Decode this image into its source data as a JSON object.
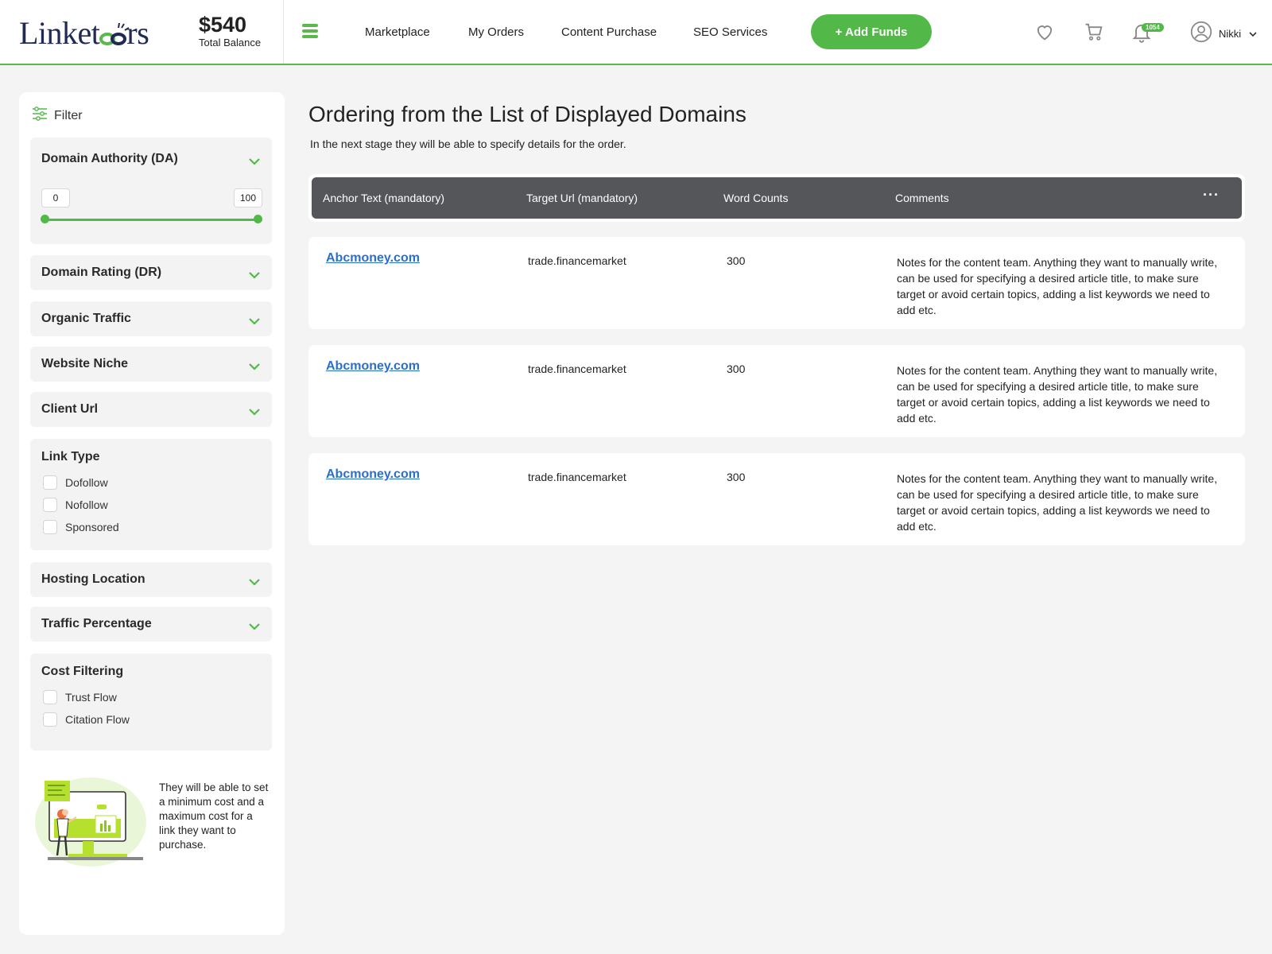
{
  "header": {
    "logo_text_a": "Linket",
    "logo_text_b": "rs",
    "balance_amount": "$540",
    "balance_label": "Total Balance",
    "nav": [
      "Marketplace",
      "My Orders",
      "Content Purchase",
      "SEO Services"
    ],
    "add_funds_label": "+ Add Funds",
    "notification_count": "1054",
    "user_name": "Nikki",
    "icons": [
      "heart-icon",
      "cart-icon",
      "bell-icon",
      "user-avatar-icon"
    ],
    "accent_color": "#52b848"
  },
  "sidebar": {
    "filter_label": "Filter",
    "domain_authority": {
      "title": "Domain Authority (DA)",
      "min": "0",
      "max": "100"
    },
    "collapsed_filters": [
      "Domain Rating (DR)",
      "Organic Traffic",
      "Website Niche",
      "Client Url"
    ],
    "link_type": {
      "title": "Link Type",
      "options": [
        "Dofollow",
        "Nofollow",
        "Sponsored"
      ]
    },
    "collapsed_filters_2": [
      "Hosting Location",
      "Traffic Percentage"
    ],
    "cost_filtering": {
      "title": "Cost Filtering",
      "options": [
        "Trust Flow",
        "Citation Flow"
      ]
    },
    "promo_text": "They will be able to set a minimum cost and a maximum cost for a link they want to purchase."
  },
  "main": {
    "title": "Ordering from the List of Displayed Domains",
    "subtitle": "In the next stage they will be able to specify details for the order.",
    "columns": [
      "Anchor Text (mandatory)",
      "Target Url (mandatory)",
      "Word Counts",
      "Comments"
    ],
    "more_label": "···",
    "rows": [
      {
        "anchor": "Abcmoney.com",
        "url": "trade.financemarket",
        "words": "300",
        "comment": "Notes for the content team. Anything they want to manually write, can be used for specifying a desired article title, to make sure target or avoid certain topics, adding a list keywords we need to add etc."
      },
      {
        "anchor": "Abcmoney.com",
        "url": "trade.financemarket",
        "words": "300",
        "comment": "Notes for the content team. Anything they want to manually write, can be used for specifying a desired article title, to make sure target or avoid certain topics, adding a list keywords we need to add etc."
      },
      {
        "anchor": "Abcmoney.com",
        "url": "trade.financemarket",
        "words": "300",
        "comment": "Notes for the content team. Anything they want to manually write, can be used for specifying a desired article title, to make sure target or avoid certain topics, adding a list keywords we need to add etc."
      }
    ]
  }
}
